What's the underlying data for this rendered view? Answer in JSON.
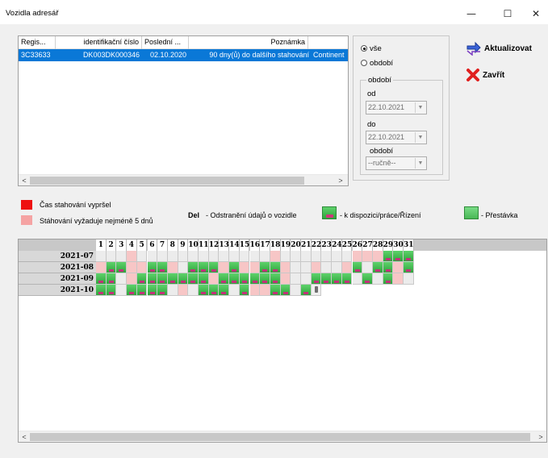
{
  "window": {
    "title": "Vozidla adresář",
    "min": "—",
    "max": "☐",
    "close": "✕"
  },
  "list": {
    "columns": [
      "Regis...",
      "identifikační číslo",
      "Poslední ...",
      "Poznámka"
    ],
    "rows": [
      [
        "3C33633",
        "DK003DK000346",
        "02.10.2020",
        "90 dny(ů) do dalšího stahování",
        "Continent"
      ]
    ]
  },
  "period": {
    "all_label": "vše",
    "period_label": "období",
    "group_title": "období",
    "from_label": "od",
    "from_value": "22.10.2021",
    "to_label": "do",
    "to_value": "22.10.2021",
    "mode_label": "období",
    "mode_value": "--ručně--",
    "selected": "all"
  },
  "actions": {
    "refresh": "Aktualizovat",
    "close": "Zavřít"
  },
  "legend": {
    "expired": "Čas stahování vypršel",
    "min_days": "Stáhování vyžaduje nejméně  5 dnů",
    "del_key": "Del",
    "del_text": "- Odstranění údajů o vozidle",
    "driving": "- k dispozici/práce/Řízení",
    "break": "- Přestávka",
    "colors": {
      "expired": "#ee1111",
      "min_days": "#f5a3a3",
      "activity": "#3fb44c"
    }
  },
  "calendar": {
    "days": [
      "1",
      "2",
      "3",
      "4",
      "5",
      "6",
      "7",
      "8",
      "9",
      "10",
      "11",
      "12",
      "13",
      "14",
      "15",
      "16",
      "17",
      "18",
      "19",
      "20",
      "21",
      "22",
      "23",
      "24",
      "25",
      "26",
      "27",
      "28",
      "29",
      "30",
      "31"
    ],
    "months": [
      {
        "label": "2021-07",
        "cells": "wwwpwwwwwwwwwwwwwpwwwwwwwpppgggwp"
      },
      {
        "label": "2021-08",
        "cells": "pggppggpwgggpgppggpwwpwwpgwggpgg"
      },
      {
        "label": "2021-09",
        "cells": "ggwpgggggggpggggggpwwggggwgwgpw"
      },
      {
        "label": "2021-10",
        "cells": "ggwggggwpwgggwgppggwgd"
      }
    ],
    "legend_note": "g = activity, p = download pending, w = none, d = delete"
  }
}
